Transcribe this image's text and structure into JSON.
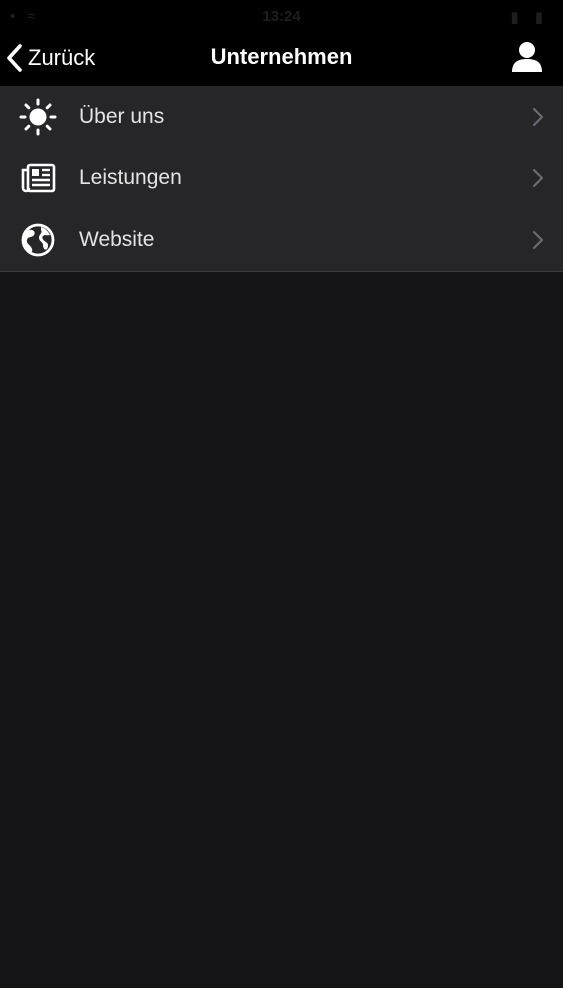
{
  "status_bar": {
    "signal": "• ≈",
    "time": "13:24",
    "battery": "▮ ▮"
  },
  "nav": {
    "back_label": "Zurück",
    "title": "Unternehmen",
    "profile_icon": "person-icon"
  },
  "menu": {
    "items": [
      {
        "label": "Über uns",
        "icon": "sun-icon"
      },
      {
        "label": "Leistungen",
        "icon": "newspaper-icon"
      },
      {
        "label": "Website",
        "icon": "globe-icon"
      }
    ]
  },
  "colors": {
    "nav_background": "#000000",
    "menu_background": "#262528",
    "screen_background": "#141315",
    "text": "#e4e4e4",
    "chevron": "#6b6a6e"
  }
}
